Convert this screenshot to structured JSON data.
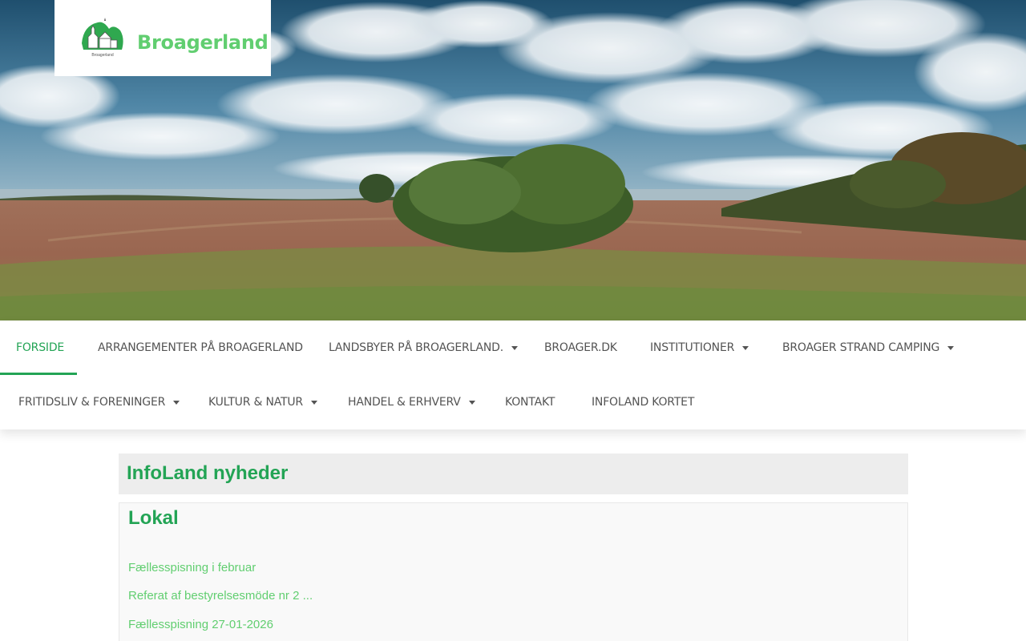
{
  "site": {
    "title": "Broagerland",
    "logo_icon": "church-on-green-hill-logo",
    "logo_caption": "Broagerland",
    "brand_color": "#61ce70",
    "accent_color": "#23a455"
  },
  "nav": {
    "row1": [
      {
        "label": "FORSIDE",
        "active": true,
        "dropdown": false
      },
      {
        "label": "ARRANGEMENTER PÅ BROAGERLAND",
        "active": false,
        "dropdown": false
      },
      {
        "label": "LANDSBYER PÅ BROAGERLAND.",
        "active": false,
        "dropdown": true
      },
      {
        "label": "BROAGER.DK",
        "active": false,
        "dropdown": false
      },
      {
        "label": "INSTITUTIONER",
        "active": false,
        "dropdown": true
      },
      {
        "label": "BROAGER STRAND CAMPING",
        "active": false,
        "dropdown": true
      }
    ],
    "row2": [
      {
        "label": "FRITIDSLIV & FORENINGER",
        "active": false,
        "dropdown": true
      },
      {
        "label": "KULTUR & NATUR",
        "active": false,
        "dropdown": true
      },
      {
        "label": "HANDEL & ERHVERV",
        "active": false,
        "dropdown": true
      },
      {
        "label": "KONTAKT",
        "active": false,
        "dropdown": false
      },
      {
        "label": "INFOLAND KORTET",
        "active": false,
        "dropdown": false
      }
    ]
  },
  "news": {
    "heading": "InfoLand nyheder",
    "section_title": "Lokal",
    "items": [
      "Fællesspisning i februar",
      "Referat af bestyrelsesmöde nr 2 ...",
      "Fællesspisning 27-01-2026"
    ]
  }
}
